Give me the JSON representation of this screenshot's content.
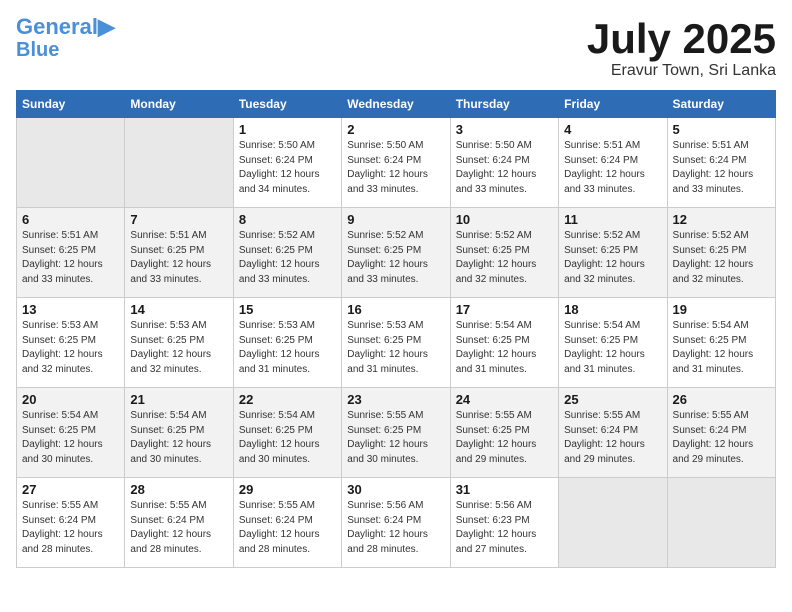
{
  "logo": {
    "line1": "General",
    "line2": "Blue"
  },
  "title": "July 2025",
  "location": "Eravur Town, Sri Lanka",
  "days_of_week": [
    "Sunday",
    "Monday",
    "Tuesday",
    "Wednesday",
    "Thursday",
    "Friday",
    "Saturday"
  ],
  "weeks": [
    [
      {
        "day": "",
        "sunrise": "",
        "sunset": "",
        "daylight": ""
      },
      {
        "day": "",
        "sunrise": "",
        "sunset": "",
        "daylight": ""
      },
      {
        "day": "1",
        "sunrise": "Sunrise: 5:50 AM",
        "sunset": "Sunset: 6:24 PM",
        "daylight": "Daylight: 12 hours and 34 minutes."
      },
      {
        "day": "2",
        "sunrise": "Sunrise: 5:50 AM",
        "sunset": "Sunset: 6:24 PM",
        "daylight": "Daylight: 12 hours and 33 minutes."
      },
      {
        "day": "3",
        "sunrise": "Sunrise: 5:50 AM",
        "sunset": "Sunset: 6:24 PM",
        "daylight": "Daylight: 12 hours and 33 minutes."
      },
      {
        "day": "4",
        "sunrise": "Sunrise: 5:51 AM",
        "sunset": "Sunset: 6:24 PM",
        "daylight": "Daylight: 12 hours and 33 minutes."
      },
      {
        "day": "5",
        "sunrise": "Sunrise: 5:51 AM",
        "sunset": "Sunset: 6:24 PM",
        "daylight": "Daylight: 12 hours and 33 minutes."
      }
    ],
    [
      {
        "day": "6",
        "sunrise": "Sunrise: 5:51 AM",
        "sunset": "Sunset: 6:25 PM",
        "daylight": "Daylight: 12 hours and 33 minutes."
      },
      {
        "day": "7",
        "sunrise": "Sunrise: 5:51 AM",
        "sunset": "Sunset: 6:25 PM",
        "daylight": "Daylight: 12 hours and 33 minutes."
      },
      {
        "day": "8",
        "sunrise": "Sunrise: 5:52 AM",
        "sunset": "Sunset: 6:25 PM",
        "daylight": "Daylight: 12 hours and 33 minutes."
      },
      {
        "day": "9",
        "sunrise": "Sunrise: 5:52 AM",
        "sunset": "Sunset: 6:25 PM",
        "daylight": "Daylight: 12 hours and 33 minutes."
      },
      {
        "day": "10",
        "sunrise": "Sunrise: 5:52 AM",
        "sunset": "Sunset: 6:25 PM",
        "daylight": "Daylight: 12 hours and 32 minutes."
      },
      {
        "day": "11",
        "sunrise": "Sunrise: 5:52 AM",
        "sunset": "Sunset: 6:25 PM",
        "daylight": "Daylight: 12 hours and 32 minutes."
      },
      {
        "day": "12",
        "sunrise": "Sunrise: 5:52 AM",
        "sunset": "Sunset: 6:25 PM",
        "daylight": "Daylight: 12 hours and 32 minutes."
      }
    ],
    [
      {
        "day": "13",
        "sunrise": "Sunrise: 5:53 AM",
        "sunset": "Sunset: 6:25 PM",
        "daylight": "Daylight: 12 hours and 32 minutes."
      },
      {
        "day": "14",
        "sunrise": "Sunrise: 5:53 AM",
        "sunset": "Sunset: 6:25 PM",
        "daylight": "Daylight: 12 hours and 32 minutes."
      },
      {
        "day": "15",
        "sunrise": "Sunrise: 5:53 AM",
        "sunset": "Sunset: 6:25 PM",
        "daylight": "Daylight: 12 hours and 31 minutes."
      },
      {
        "day": "16",
        "sunrise": "Sunrise: 5:53 AM",
        "sunset": "Sunset: 6:25 PM",
        "daylight": "Daylight: 12 hours and 31 minutes."
      },
      {
        "day": "17",
        "sunrise": "Sunrise: 5:54 AM",
        "sunset": "Sunset: 6:25 PM",
        "daylight": "Daylight: 12 hours and 31 minutes."
      },
      {
        "day": "18",
        "sunrise": "Sunrise: 5:54 AM",
        "sunset": "Sunset: 6:25 PM",
        "daylight": "Daylight: 12 hours and 31 minutes."
      },
      {
        "day": "19",
        "sunrise": "Sunrise: 5:54 AM",
        "sunset": "Sunset: 6:25 PM",
        "daylight": "Daylight: 12 hours and 31 minutes."
      }
    ],
    [
      {
        "day": "20",
        "sunrise": "Sunrise: 5:54 AM",
        "sunset": "Sunset: 6:25 PM",
        "daylight": "Daylight: 12 hours and 30 minutes."
      },
      {
        "day": "21",
        "sunrise": "Sunrise: 5:54 AM",
        "sunset": "Sunset: 6:25 PM",
        "daylight": "Daylight: 12 hours and 30 minutes."
      },
      {
        "day": "22",
        "sunrise": "Sunrise: 5:54 AM",
        "sunset": "Sunset: 6:25 PM",
        "daylight": "Daylight: 12 hours and 30 minutes."
      },
      {
        "day": "23",
        "sunrise": "Sunrise: 5:55 AM",
        "sunset": "Sunset: 6:25 PM",
        "daylight": "Daylight: 12 hours and 30 minutes."
      },
      {
        "day": "24",
        "sunrise": "Sunrise: 5:55 AM",
        "sunset": "Sunset: 6:25 PM",
        "daylight": "Daylight: 12 hours and 29 minutes."
      },
      {
        "day": "25",
        "sunrise": "Sunrise: 5:55 AM",
        "sunset": "Sunset: 6:24 PM",
        "daylight": "Daylight: 12 hours and 29 minutes."
      },
      {
        "day": "26",
        "sunrise": "Sunrise: 5:55 AM",
        "sunset": "Sunset: 6:24 PM",
        "daylight": "Daylight: 12 hours and 29 minutes."
      }
    ],
    [
      {
        "day": "27",
        "sunrise": "Sunrise: 5:55 AM",
        "sunset": "Sunset: 6:24 PM",
        "daylight": "Daylight: 12 hours and 28 minutes."
      },
      {
        "day": "28",
        "sunrise": "Sunrise: 5:55 AM",
        "sunset": "Sunset: 6:24 PM",
        "daylight": "Daylight: 12 hours and 28 minutes."
      },
      {
        "day": "29",
        "sunrise": "Sunrise: 5:55 AM",
        "sunset": "Sunset: 6:24 PM",
        "daylight": "Daylight: 12 hours and 28 minutes."
      },
      {
        "day": "30",
        "sunrise": "Sunrise: 5:56 AM",
        "sunset": "Sunset: 6:24 PM",
        "daylight": "Daylight: 12 hours and 28 minutes."
      },
      {
        "day": "31",
        "sunrise": "Sunrise: 5:56 AM",
        "sunset": "Sunset: 6:23 PM",
        "daylight": "Daylight: 12 hours and 27 minutes."
      },
      {
        "day": "",
        "sunrise": "",
        "sunset": "",
        "daylight": ""
      },
      {
        "day": "",
        "sunrise": "",
        "sunset": "",
        "daylight": ""
      }
    ]
  ]
}
